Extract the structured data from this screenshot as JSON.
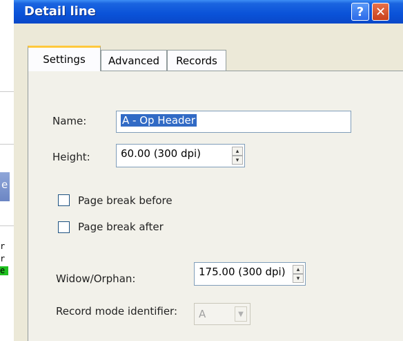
{
  "background": {
    "blue_char": "e",
    "code_chars": [
      "r",
      "r",
      "e"
    ]
  },
  "dialog": {
    "title": "Detail line",
    "help_glyph": "?",
    "close_glyph": "✕",
    "tabs": [
      {
        "label": "Settings",
        "active": true
      },
      {
        "label": "Advanced",
        "active": false
      },
      {
        "label": "Records",
        "active": false
      }
    ],
    "settings": {
      "name_label": "Name:",
      "name_value": "A - Op Header",
      "height_label": "Height:",
      "height_value": "60.00 (300 dpi)",
      "page_break_before_label": "Page break before",
      "page_break_before_checked": false,
      "page_break_after_label": "Page break after",
      "page_break_after_checked": false,
      "widow_orphan_label": "Widow/Orphan:",
      "widow_orphan_value": "175.00 (300 dpi)",
      "record_mode_label": "Record mode identifier:",
      "record_mode_value": "A"
    }
  },
  "colors": {
    "titlebar": "#0a52d8",
    "dialog_bg": "#ece9d8",
    "selection": "#316ac5",
    "active_tab_accent": "#ffc83c"
  }
}
